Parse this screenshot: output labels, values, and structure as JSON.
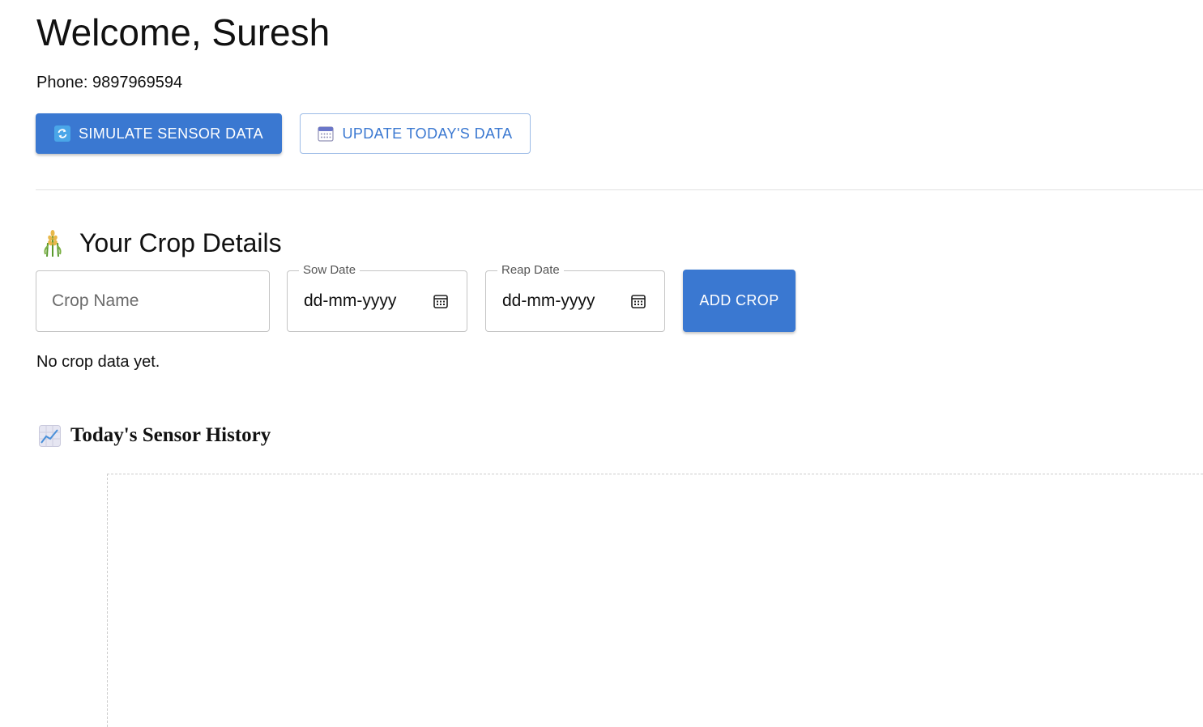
{
  "user": {
    "welcome": "Welcome, Suresh",
    "phone": "Phone: 9897969594"
  },
  "actions": {
    "simulate_label": "SIMULATE SENSOR DATA",
    "update_label": "UPDATE TODAY'S DATA"
  },
  "crop_section": {
    "title": "Your Crop Details",
    "crop_name_placeholder": "Crop Name",
    "sow_label": "Sow Date",
    "sow_value": "dd-mm-yyyy",
    "reap_label": "Reap Date",
    "reap_value": "dd-mm-yyyy",
    "add_label": "ADD CROP",
    "empty_text": "No crop data yet."
  },
  "history": {
    "title": "Today's Sensor History"
  },
  "colors": {
    "primary": "#3a78d1",
    "outline": "#9cbbe6"
  },
  "icons": {
    "simulate": "refresh-icon",
    "update": "calendar-icon",
    "crop": "wheat-icon",
    "date_picker": "calendar-icon",
    "history": "chart-increasing-icon"
  }
}
